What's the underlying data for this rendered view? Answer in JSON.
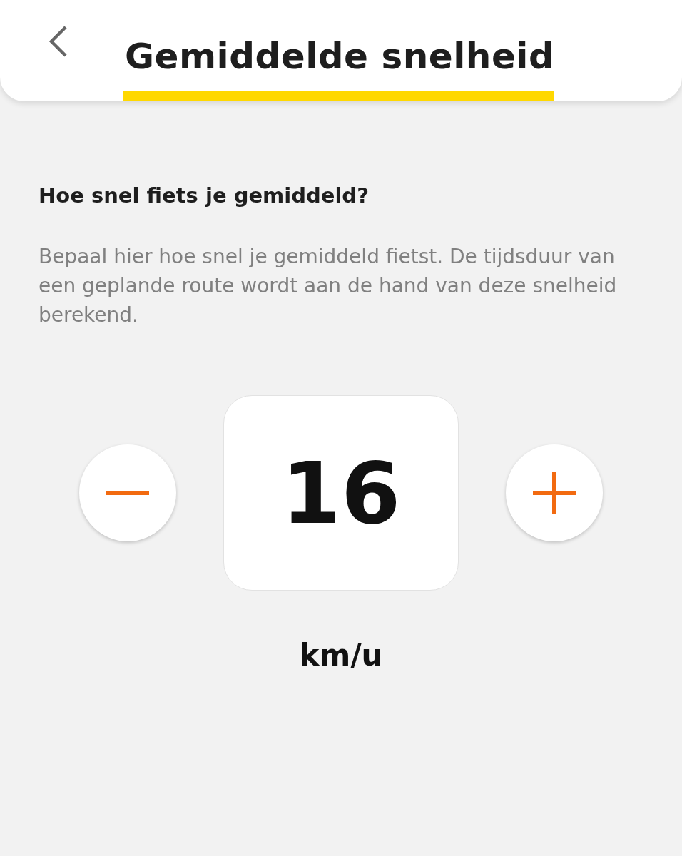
{
  "header": {
    "title": "Gemiddelde snelheid"
  },
  "question": "Hoe snel fiets je gemiddeld?",
  "description": "Bepaal hier hoe snel je gemiddeld fietst. De tijdsduur van een geplande route wordt aan de hand van deze snelheid berekend.",
  "stepper": {
    "value": "16",
    "unit": "km/u"
  }
}
